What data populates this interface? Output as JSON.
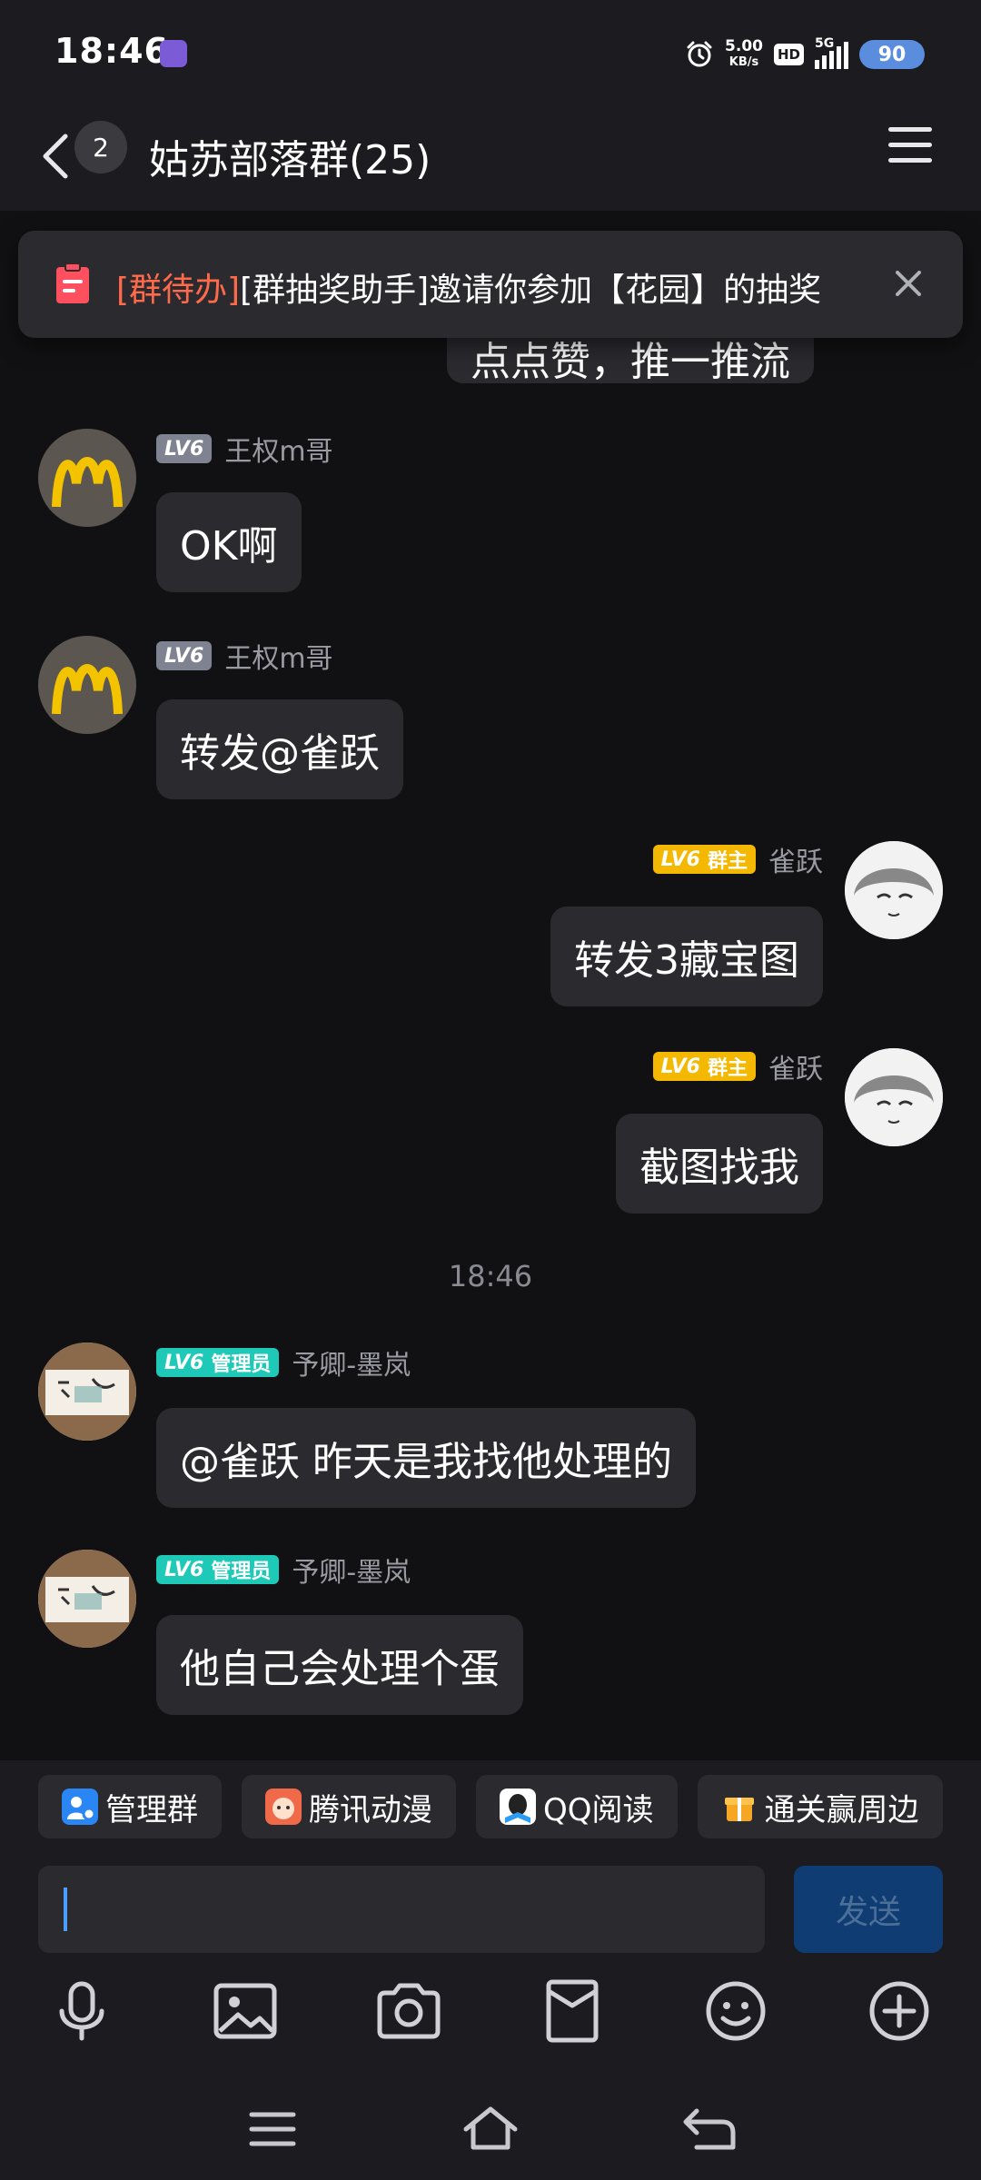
{
  "status_bar": {
    "time": "18:46",
    "net_speed_value": "5.00",
    "net_speed_unit": "KB/s",
    "hd": "HD",
    "network": "5G",
    "battery": "90"
  },
  "header": {
    "unread_count": "2",
    "title": "姑苏部落群(25)"
  },
  "notice": {
    "tag": "[群待办]",
    "text": "[群抽奖助手]邀请你参加【花园】的抽奖"
  },
  "partial_message": "点点赞，推一推流",
  "messages": [
    {
      "sender": "王权m哥",
      "level": "LV6",
      "text": "OK啊"
    },
    {
      "sender": "王权m哥",
      "level": "LV6",
      "text": "转发@雀跃"
    },
    {
      "sender": "雀跃",
      "level": "LV6",
      "role": "群主",
      "text": "转发3藏宝图"
    },
    {
      "sender": "雀跃",
      "level": "LV6",
      "role": "群主",
      "text": "截图找我"
    },
    {
      "sender": "予卿-墨岚",
      "level": "LV6",
      "role": "管理员",
      "text": "@雀跃 昨天是我找他处理的"
    },
    {
      "sender": "予卿-墨岚",
      "level": "LV6",
      "role": "管理员",
      "text": "他自己会处理个蛋"
    }
  ],
  "timestamp": "18:46",
  "quick_actions": [
    "管理群",
    "腾讯动漫",
    "QQ阅读",
    "通关赢周边"
  ],
  "input": {
    "value": ""
  },
  "send_label": "发送",
  "colors": {
    "background": "#111113",
    "bubble": "#2a2a2f",
    "owner_badge": "#f5b800",
    "admin_badge": "#1fc9b8",
    "notice_tag": "#ff6a4a",
    "send_button": "#0f3d73"
  },
  "icons": {
    "toolbar": [
      "microphone-icon",
      "image-icon",
      "camera-icon",
      "red-packet-icon",
      "emoji-icon",
      "plus-icon"
    ],
    "nav": [
      "recent-apps-icon",
      "home-icon",
      "back-icon"
    ]
  }
}
